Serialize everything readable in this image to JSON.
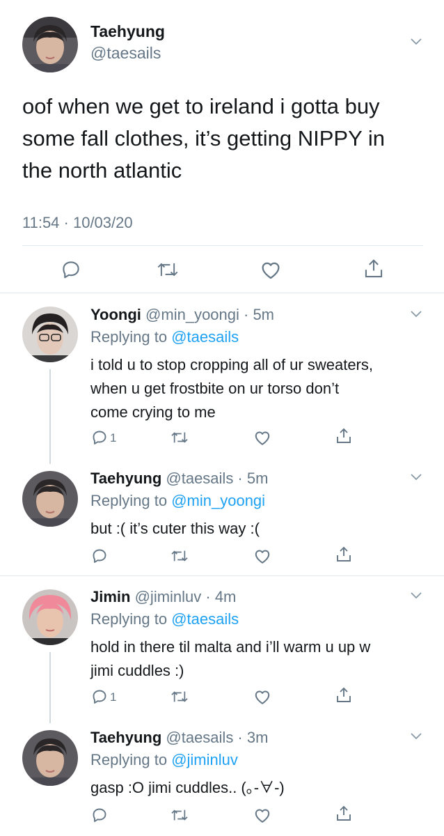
{
  "main_tweet": {
    "name": "Taehyung",
    "handle": "@taesails",
    "text_lines": [
      "oof when we get to ireland i gotta buy",
      "some fall clothes, it’s getting NIPPY in",
      "the north atlantic"
    ],
    "timestamp": "11:54 · 10/03/20"
  },
  "replies": [
    {
      "name": "Yoongi",
      "handle_time": "@min_yoongi · 5m",
      "replying_prefix": "Replying to",
      "replying_to": "@taesails",
      "text_lines": [
        "i told u to stop cropping all of ur sweaters,",
        "when u get frostbite on ur torso don’t",
        "come crying to me"
      ],
      "reply_count": "1"
    },
    {
      "name": "Taehyung",
      "handle_time": "@taesails · 5m",
      "replying_prefix": "Replying to",
      "replying_to": "@min_yoongi",
      "text_lines": [
        "but :( it’s cuter this way :("
      ],
      "reply_count": ""
    },
    {
      "name": "Jimin",
      "handle_time": "@jiminluv · 4m",
      "replying_prefix": "Replying to",
      "replying_to": "@taesails",
      "text_lines": [
        "hold in there til malta and i’ll warm u up w",
        "jimi cuddles :)"
      ],
      "reply_count": "1"
    },
    {
      "name": "Taehyung",
      "handle_time": "@taesails · 3m",
      "replying_prefix": "Replying to",
      "replying_to": "@jiminluv",
      "text_lines": [
        "gasp :O jimi cuddles.. (｡-∀-)"
      ],
      "reply_count": ""
    }
  ],
  "colors": {
    "accent": "#1da1f2",
    "secondary_text": "#657786",
    "text": "#14171a",
    "divider": "#e1e8ed"
  }
}
